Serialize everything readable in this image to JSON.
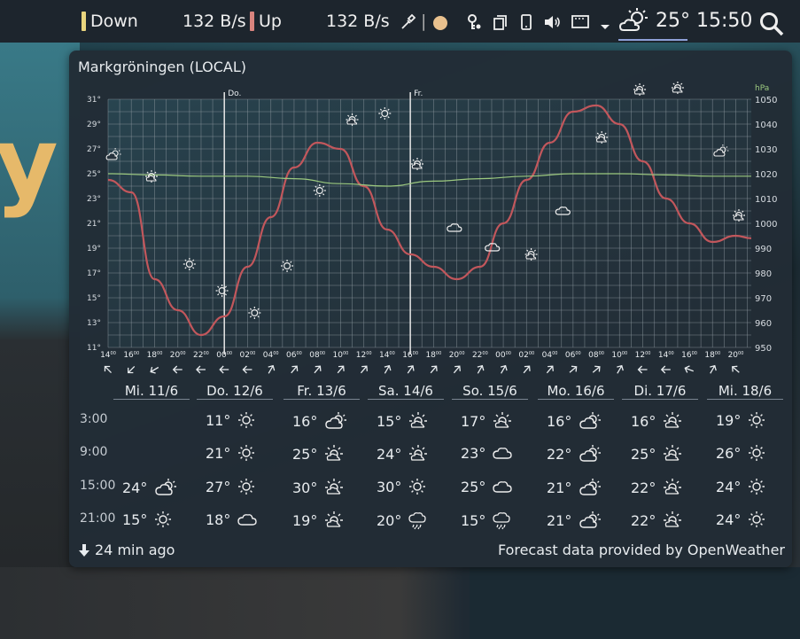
{
  "panel": {
    "down_label": "Down",
    "down_rate": "132 B/s",
    "up_label": "Up",
    "up_rate": "132 B/s",
    "separator": "|",
    "temperature": "25°",
    "clock": "15:50",
    "colors": {
      "down_bar": "#e9d57e",
      "up_bar": "#d9847e",
      "status_dot": "#e9c18e"
    }
  },
  "popup": {
    "location": "Markgröningen (LOCAL)",
    "updated": "24 min ago",
    "credit": "Forecast data provided by OpenWeather"
  },
  "chart_data": {
    "type": "line",
    "day_markers": [
      "Do.",
      "Fr."
    ],
    "y_left_ticks": [
      "31°",
      "29°",
      "27°",
      "25°",
      "23°",
      "21°",
      "19°",
      "17°",
      "15°",
      "13°",
      "11°"
    ],
    "y_right_unit": "hPa",
    "y_right_ticks": [
      "1050",
      "1040",
      "1030",
      "1020",
      "1010",
      "1000",
      "990",
      "980",
      "970",
      "960",
      "950"
    ],
    "x_hours": [
      "14",
      "16",
      "18",
      "20",
      "22",
      "00",
      "02",
      "04",
      "06",
      "08",
      "10",
      "12",
      "14",
      "16",
      "18",
      "20",
      "22",
      "00",
      "02",
      "04",
      "06",
      "08",
      "10",
      "12",
      "14",
      "16",
      "18",
      "20"
    ],
    "series": [
      {
        "color": "#c2575c",
        "x_hours_from_start": [
          0,
          3,
          6,
          9,
          12,
          15,
          18,
          21,
          24,
          27,
          30,
          33,
          36,
          39,
          42,
          45,
          48,
          51,
          54,
          57,
          60,
          63,
          66,
          69,
          72,
          75,
          78,
          81,
          83
        ],
        "values": [
          24.5,
          23.5,
          16.5,
          14.0,
          12.0,
          13.5,
          17.5,
          21.5,
          25.5,
          27.5,
          27.0,
          24.0,
          20.5,
          18.5,
          17.5,
          16.5,
          17.5,
          21.0,
          24.5,
          27.5,
          30.0,
          30.5,
          29.0,
          26.0,
          23.0,
          21.0,
          19.5,
          20.0,
          19.8
        ]
      },
      {
        "color": "#9cc97f",
        "x_hours_from_start": [
          0,
          6,
          12,
          18,
          24,
          30,
          36,
          42,
          48,
          54,
          60,
          66,
          72,
          78,
          83
        ],
        "values": [
          1020,
          1019.5,
          1019,
          1019,
          1018,
          1016,
          1015,
          1017,
          1018,
          1019,
          1020,
          1020,
          1019.5,
          1019,
          1019
        ]
      }
    ],
    "ylim": [
      11,
      31
    ],
    "y_right_lim": [
      950,
      1050
    ],
    "grid": true
  },
  "forecast": {
    "times": [
      "3:00",
      "9:00",
      "15:00",
      "21:00"
    ],
    "days": [
      {
        "label": "Mi. 11/6",
        "cells": [
          null,
          null,
          {
            "temp": "24°",
            "icon": "partly-cloudy-icon"
          },
          {
            "temp": "15°",
            "icon": "sun-icon"
          }
        ]
      },
      {
        "label": "Do. 12/6",
        "cells": [
          {
            "temp": "11°",
            "icon": "sun-icon"
          },
          {
            "temp": "21°",
            "icon": "sun-icon"
          },
          {
            "temp": "27°",
            "icon": "sun-icon"
          },
          {
            "temp": "18°",
            "icon": "cloud-icon"
          }
        ]
      },
      {
        "label": "Fr. 13/6",
        "cells": [
          {
            "temp": "16°",
            "icon": "partly-cloudy-icon"
          },
          {
            "temp": "25°",
            "icon": "mostly-sunny-icon"
          },
          {
            "temp": "30°",
            "icon": "mostly-sunny-icon"
          },
          {
            "temp": "19°",
            "icon": "mostly-sunny-icon"
          }
        ]
      },
      {
        "label": "Sa. 14/6",
        "cells": [
          {
            "temp": "15°",
            "icon": "mostly-sunny-icon"
          },
          {
            "temp": "24°",
            "icon": "mostly-sunny-icon"
          },
          {
            "temp": "30°",
            "icon": "sun-icon"
          },
          {
            "temp": "20°",
            "icon": "rain-cloud-icon"
          }
        ]
      },
      {
        "label": "So. 15/6",
        "cells": [
          {
            "temp": "17°",
            "icon": "mostly-sunny-icon"
          },
          {
            "temp": "23°",
            "icon": "cloud-icon"
          },
          {
            "temp": "25°",
            "icon": "cloud-icon"
          },
          {
            "temp": "15°",
            "icon": "rain-cloud-icon"
          }
        ]
      },
      {
        "label": "Mo. 16/6",
        "cells": [
          {
            "temp": "16°",
            "icon": "partly-cloudy-icon"
          },
          {
            "temp": "22°",
            "icon": "partly-cloudy-icon"
          },
          {
            "temp": "21°",
            "icon": "partly-cloudy-icon"
          },
          {
            "temp": "21°",
            "icon": "partly-cloudy-icon"
          }
        ]
      },
      {
        "label": "Di. 17/6",
        "cells": [
          {
            "temp": "16°",
            "icon": "mostly-sunny-icon"
          },
          {
            "temp": "25°",
            "icon": "mostly-sunny-icon"
          },
          {
            "temp": "22°",
            "icon": "mostly-sunny-icon"
          },
          {
            "temp": "22°",
            "icon": "mostly-sunny-icon"
          }
        ]
      },
      {
        "label": "Mi. 18/6",
        "cells": [
          {
            "temp": "19°",
            "icon": "sun-icon"
          },
          {
            "temp": "26°",
            "icon": "sun-icon"
          },
          {
            "temp": "24°",
            "icon": "sun-icon"
          },
          {
            "temp": "24°",
            "icon": "sun-icon"
          }
        ]
      }
    ]
  }
}
